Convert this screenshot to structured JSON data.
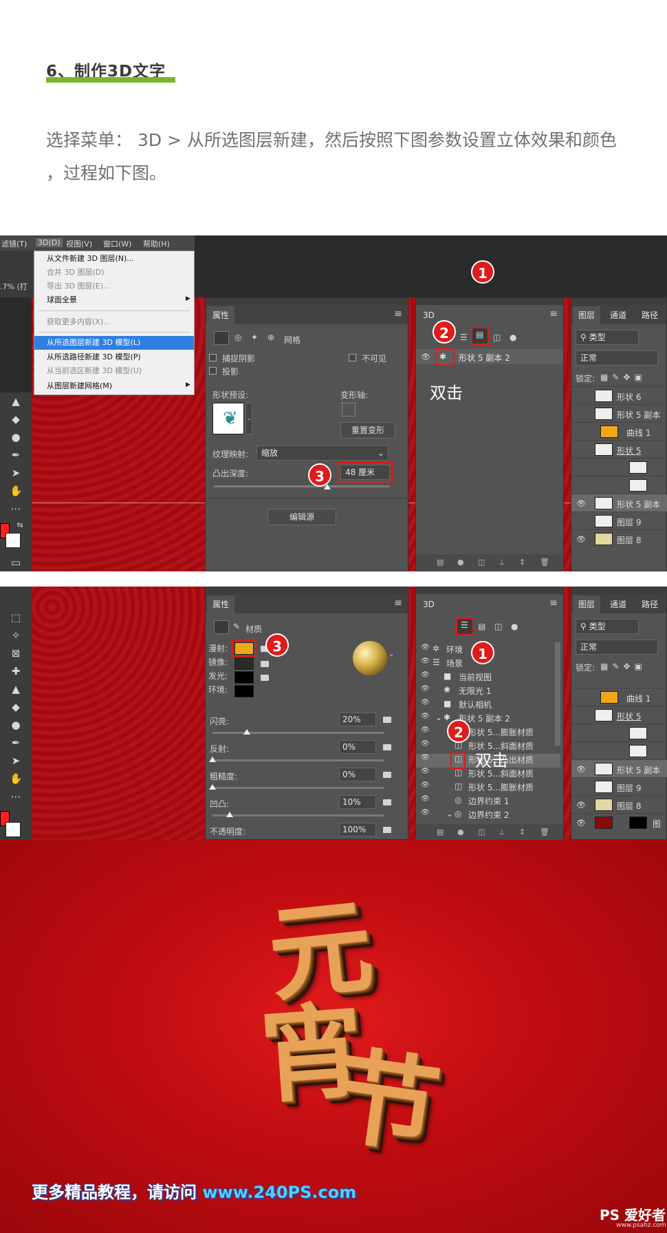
{
  "article": {
    "heading": "6、制作3D文字",
    "intro_line1": "选择菜单： 3D > 从所选图层新建，然后按照下图参数设置立体效果和颜色",
    "intro_line2": "，过程如下图。"
  },
  "colors": {
    "accent_underline": "#7ab62c",
    "badge": "#e01b1b",
    "diffuse_color": "#f0a81a",
    "menu_selected": "#2f7fe0"
  },
  "screenshot1": {
    "menubar": [
      "滤镜(T)",
      "3D(D)",
      "视图(V)",
      "窗口(W)",
      "帮助(H)"
    ],
    "status_zoom": ".7% (打 ",
    "menu_items": [
      {
        "label": "从文件新建 3D 图层(N)...",
        "dim": false,
        "selected": false
      },
      {
        "label": "合并 3D 图层(D)",
        "dim": true,
        "selected": false
      },
      {
        "label": "导出 3D 图层(E)...",
        "dim": true,
        "selected": false
      },
      {
        "label": "球面全景",
        "dim": false,
        "selected": false
      },
      {
        "label": "获取更多内容(X)...",
        "dim": true,
        "selected": false
      },
      {
        "label": "从所选图层新建 3D 模型(L)",
        "dim": false,
        "selected": true
      },
      {
        "label": "从所选路径新建 3D 模型(P)",
        "dim": false,
        "selected": false
      },
      {
        "label": "从当前选区新建 3D 模型(U)",
        "dim": true,
        "selected": false
      },
      {
        "label": "从图层新建网格(M)",
        "dim": false,
        "selected": false
      }
    ],
    "properties": {
      "tab": "属性",
      "mesh_label": "网格",
      "capture_shadow": "捕捉阴影",
      "invisible": "不可见",
      "cast_shadow": "投影",
      "shape_preset": "形状预设:",
      "deform_axis": "变形轴:",
      "reset_deform": "重置变形",
      "texture_mapping": "纹理映射:",
      "texture_mapping_value": "缩放",
      "extrusion_depth": "凸出深度:",
      "extrusion_value": "48 厘米",
      "edit_source": "编辑源"
    },
    "panel3d": {
      "tab": "3D",
      "layer_name": "形状 5 副本 2",
      "hint": "双击"
    },
    "layers": {
      "tabs": [
        "图层",
        "通道",
        "路径"
      ],
      "filter": "类型",
      "blend": "正常",
      "lock_label": "锁定:",
      "rows": [
        "形状 6",
        "形状 5 副本",
        "曲线 1",
        "形状 5",
        "",
        "",
        "形状 5 副本",
        "图层 9",
        "图层 8"
      ]
    },
    "badges": [
      "1",
      "2",
      "3"
    ]
  },
  "screenshot2": {
    "properties": {
      "tab": "属性",
      "material_label": "材质",
      "diffuse": "漫射:",
      "specular": "镜像:",
      "glow": "发光:",
      "ambient": "环境:",
      "shine": "闪亮:",
      "shine_value": "20%",
      "reflection": "反射:",
      "reflection_value": "0%",
      "roughness": "粗糙度:",
      "roughness_value": "0%",
      "bump": "凹凸:",
      "bump_value": "10%",
      "opacity": "不透明度:",
      "opacity_value": "100%"
    },
    "panel3d": {
      "tab": "3D",
      "hint": "双击",
      "rows": [
        "环境",
        "场景",
        "当前视图",
        "无限光 1",
        "默认相机",
        "形状 5 副本 2",
        "形状 5...膨胀材质",
        "形状 5...斜面材质",
        "形状 5...凸出材质",
        "形状 5...斜面材质",
        "形状 5...膨胀材质",
        "边界约束 1",
        "边界约束 2"
      ]
    },
    "layers": {
      "tabs": [
        "图层",
        "通道",
        "路径"
      ],
      "filter": "类型",
      "blend": "正常",
      "lock_label": "锁定:",
      "rows": [
        "曲线 1",
        "形状 5",
        "",
        "",
        "形状 5 副本",
        "图层 9",
        "图层 8",
        "图"
      ]
    },
    "badges": [
      "1",
      "2",
      "3"
    ]
  },
  "result": {
    "chars": [
      "元",
      "宵",
      "节"
    ],
    "footer_prefix": "更多精品教程，请访问 ",
    "footer_url": "www.240PS.com",
    "watermark": "PS 爱好者",
    "watermark_sub": "www.psahz.com"
  }
}
